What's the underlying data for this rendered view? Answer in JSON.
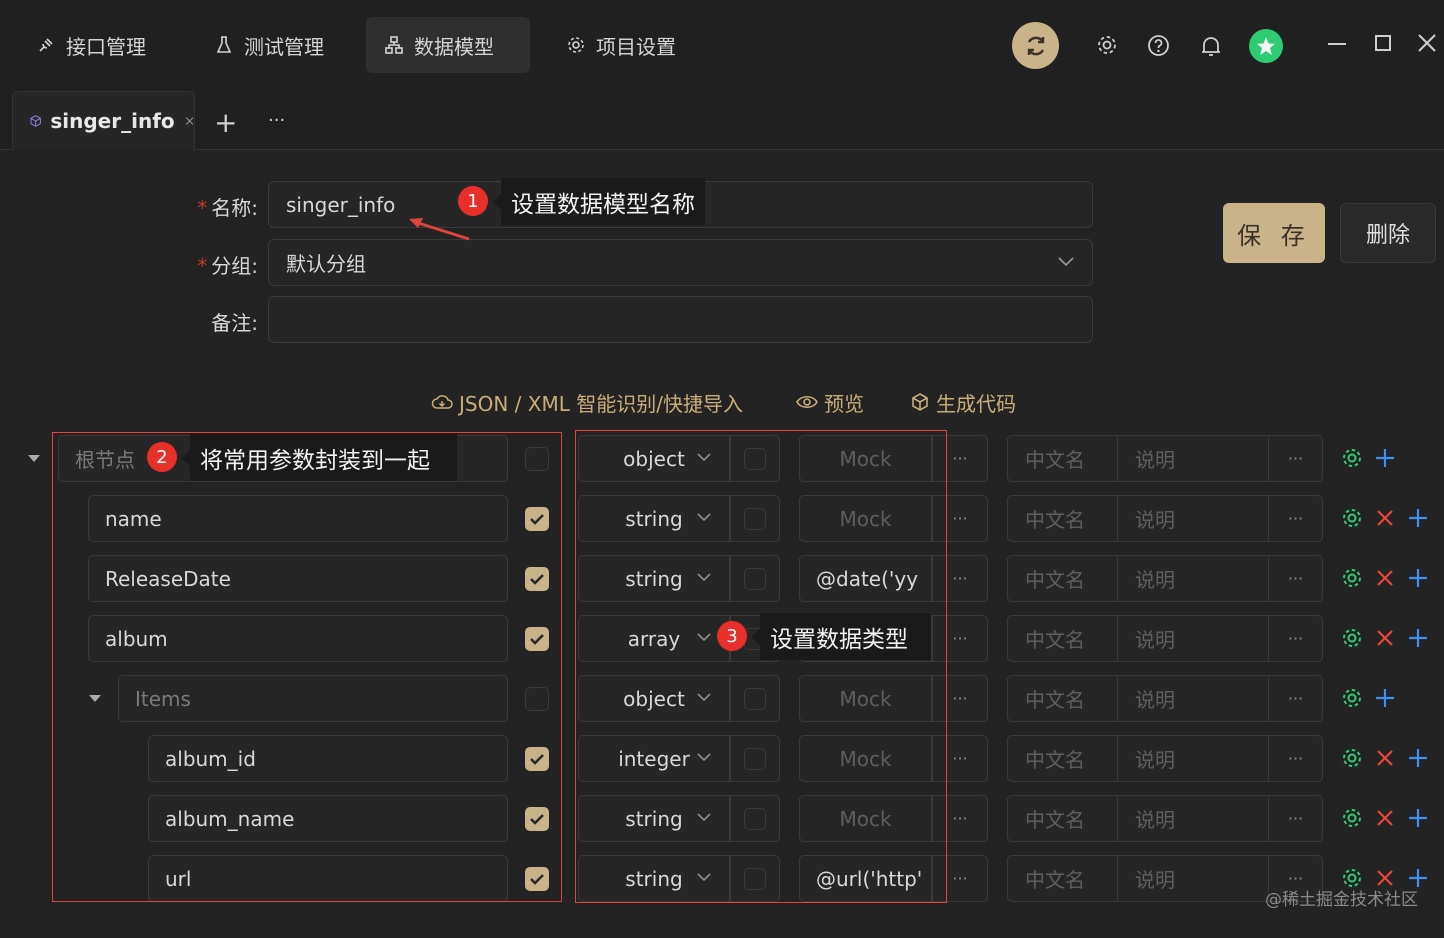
{
  "nav": {
    "items": [
      {
        "label": "接口管理",
        "icon": "plug-icon"
      },
      {
        "label": "测试管理",
        "icon": "flask-icon"
      },
      {
        "label": "数据模型",
        "icon": "hierarchy-icon"
      },
      {
        "label": "项目设置",
        "icon": "gear-icon"
      }
    ],
    "active": "数据模型"
  },
  "tabs": {
    "current": "singer_info",
    "add_label": "+",
    "more_label": "···"
  },
  "form": {
    "name_label": "名称:",
    "name_value": "singer_info",
    "group_label": "分组:",
    "group_value": "默认分组",
    "note_label": "备注:",
    "note_value": "",
    "required_mark": "*"
  },
  "buttons": {
    "save": "保 存",
    "delete": "删除"
  },
  "toolbar": {
    "import": "JSON / XML 智能识别/快捷导入",
    "preview": "预览",
    "generate": "生成代码"
  },
  "rows": [
    {
      "name": "根节点",
      "type": "object",
      "mock": "Mock",
      "required": false,
      "deletable": false,
      "placeholder_name": true
    },
    {
      "name": "name",
      "type": "string",
      "mock": "Mock",
      "required": true,
      "deletable": true
    },
    {
      "name": "ReleaseDate",
      "type": "string",
      "mock": "@date('yy",
      "required": true,
      "deletable": true,
      "mock_set": true
    },
    {
      "name": "album",
      "type": "array",
      "mock": "Mock",
      "required": true,
      "deletable": true
    },
    {
      "name": "Items",
      "type": "object",
      "mock": "Mock",
      "required": false,
      "deletable": false,
      "placeholder_name": true
    },
    {
      "name": "album_id",
      "type": "integer",
      "mock": "Mock",
      "required": true,
      "deletable": true
    },
    {
      "name": "album_name",
      "type": "string",
      "mock": "Mock",
      "required": true,
      "deletable": true
    },
    {
      "name": "url",
      "type": "string",
      "mock": "@url('http'",
      "required": true,
      "deletable": true,
      "mock_set": true
    }
  ],
  "columns": {
    "cn_name_placeholder": "中文名",
    "desc_placeholder": "说明",
    "more": "···"
  },
  "callouts": [
    {
      "num": "1",
      "text": "设置数据模型名称"
    },
    {
      "num": "2",
      "text": "将常用参数封装到一起"
    },
    {
      "num": "3",
      "text": "设置数据类型"
    }
  ],
  "watermark": "@稀土掘金技术社区",
  "colors": {
    "accent": "#c9b48a",
    "toolbar": "#c9ad78",
    "gear": "#2ecc71",
    "delete": "#e8453c",
    "add": "#3b8ff5",
    "annotation": "#e0443e"
  }
}
